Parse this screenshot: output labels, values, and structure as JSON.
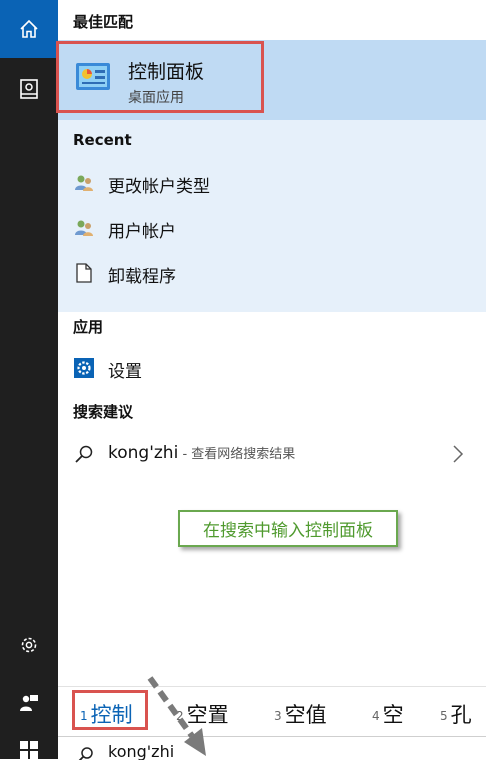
{
  "sections": {
    "best_match": "最佳匹配",
    "recent": "Recent",
    "apps": "应用",
    "suggestions": "搜索建议"
  },
  "best_match": {
    "title": "控制面板",
    "subtitle": "桌面应用"
  },
  "recent_items": [
    {
      "label": "更改帐户类型",
      "icon": "users-icon"
    },
    {
      "label": "用户帐户",
      "icon": "users-icon"
    },
    {
      "label": "卸载程序",
      "icon": "document-icon"
    }
  ],
  "apps": [
    {
      "label": "设置",
      "icon": "settings-gear-icon"
    }
  ],
  "suggestion": {
    "query": "kong'zhi",
    "sub": " - 查看网络搜索结果"
  },
  "annotation": "在搜索中输入控制面板",
  "ime_candidates": [
    {
      "num": "1",
      "text": "控制"
    },
    {
      "num": "2",
      "text": "空置"
    },
    {
      "num": "3",
      "text": "空值"
    },
    {
      "num": "4",
      "text": "空"
    },
    {
      "num": "5",
      "text": "孔"
    }
  ],
  "search_input": {
    "value": "kong'zhi"
  },
  "colors": {
    "accent": "#0a63b5",
    "rail": "#1f1f1f",
    "best_match_bg": "#bfdaf3",
    "recent_bg": "#e6f0fa",
    "highlight_border": "#d9534f",
    "note_green": "#4f9a2e"
  }
}
